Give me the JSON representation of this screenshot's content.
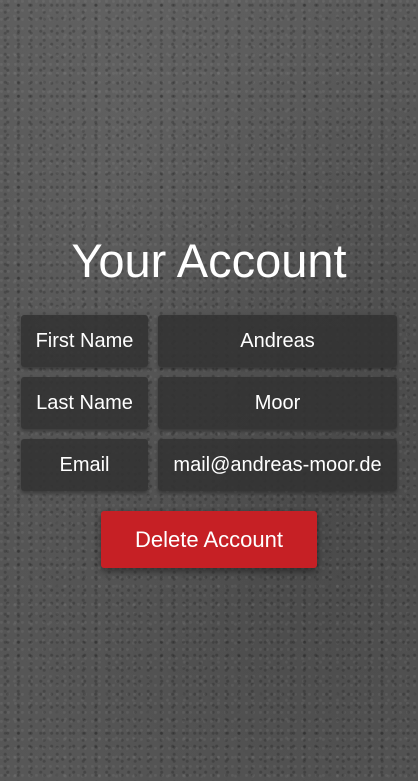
{
  "page": {
    "title": "Your Account"
  },
  "form": {
    "fields": [
      {
        "label": "First Name",
        "value": "Andreas"
      },
      {
        "label": "Last Name",
        "value": "Moor"
      },
      {
        "label": "Email",
        "value": "mail@andreas-moor.de"
      }
    ]
  },
  "actions": {
    "delete_label": "Delete Account"
  },
  "colors": {
    "danger": "#c62025",
    "field_background": "#323232",
    "text": "#ffffff"
  }
}
